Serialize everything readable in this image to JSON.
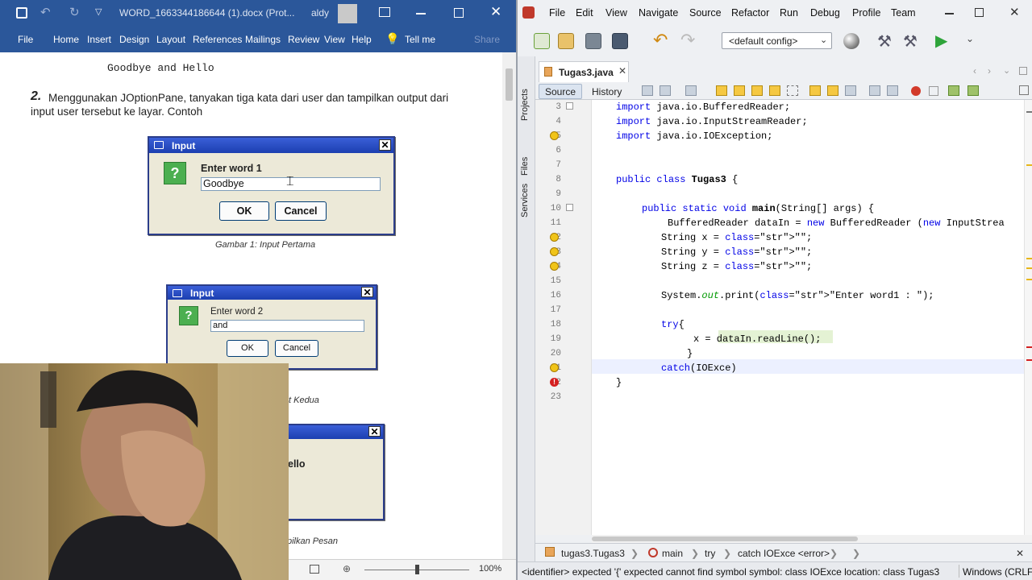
{
  "word": {
    "doc_title": "WORD_1663344186644 (1).docx (Prot...",
    "user": "aldy",
    "ribbon_tabs": [
      "File",
      "Home",
      "Insert",
      "Design",
      "Layout",
      "References",
      "Mailings",
      "Review",
      "View",
      "Help",
      "Tell me",
      "Share"
    ],
    "doc_line1": "Goodbye and Hello",
    "item_number": "2.",
    "item_text1": "Menggunakan JOptionPane, tanyakan tiga kata dari user dan tampilkan output dari",
    "item_text2": "input user tersebut ke layar. Contoh",
    "dialog1": {
      "title": "Input",
      "prompt": "Enter word 1",
      "value": "Goodbye",
      "ok": "OK",
      "cancel": "Cancel",
      "icon": "?"
    },
    "caption1": "Gambar 1: Input Pertama",
    "dialog2": {
      "title": "Input",
      "prompt": "Enter word 2",
      "value": "and",
      "ok": "OK",
      "cancel": "Cancel",
      "icon": "?"
    },
    "caption2_partial": "t Kedua",
    "dialog3_partial": "ello",
    "caption3_partial": "pilkan Pesan",
    "zoom": "100%"
  },
  "netbeans": {
    "menu": [
      "File",
      "Edit",
      "View",
      "Navigate",
      "Source",
      "Refactor",
      "Run",
      "Debug",
      "Profile",
      "Team"
    ],
    "config": "<default config>",
    "side_tabs": [
      "Projects",
      "Files",
      "Services"
    ],
    "file_tab": "Tugas3.java",
    "editor_tabs": [
      "Source",
      "History"
    ],
    "lines": [
      {
        "n": "3",
        "code": "import java.io.BufferedReader;"
      },
      {
        "n": "4",
        "code": "import java.io.InputStreamReader;"
      },
      {
        "n": "5",
        "code": "import java.io.IOException;"
      },
      {
        "n": "6",
        "code": ""
      },
      {
        "n": "7",
        "code": ""
      },
      {
        "n": "8",
        "code": "public class Tugas3 {"
      },
      {
        "n": "9",
        "code": ""
      },
      {
        "n": "10",
        "code": "public static void main(String[] args) {"
      },
      {
        "n": "11",
        "code": "BufferedReader dataIn = new BufferedReader (new InputStrea"
      },
      {
        "n": "12",
        "code": "String x = \"\";"
      },
      {
        "n": "13",
        "code": "String y = \"\";"
      },
      {
        "n": "14",
        "code": "String z = \"\";"
      },
      {
        "n": "15",
        "code": ""
      },
      {
        "n": "16",
        "code": "System.out.print(\"Enter word1 : \");"
      },
      {
        "n": "17",
        "code": ""
      },
      {
        "n": "18",
        "code": "try{"
      },
      {
        "n": "19",
        "code": "x = dataIn.readLine();"
      },
      {
        "n": "20",
        "code": "}"
      },
      {
        "n": "21",
        "code": "catch(IOExce)"
      },
      {
        "n": "22",
        "code": "}"
      },
      {
        "n": "23",
        "code": ""
      }
    ],
    "breadcrumb": [
      "tugas3.Tugas3",
      "main",
      "try",
      "catch IOExce <error>"
    ],
    "status_text": "<identifier> expected  '{' expected  cannot find symbol  symbol: class IOExce  location: class Tugas3",
    "line_ending": "Windows (CRLF)"
  }
}
